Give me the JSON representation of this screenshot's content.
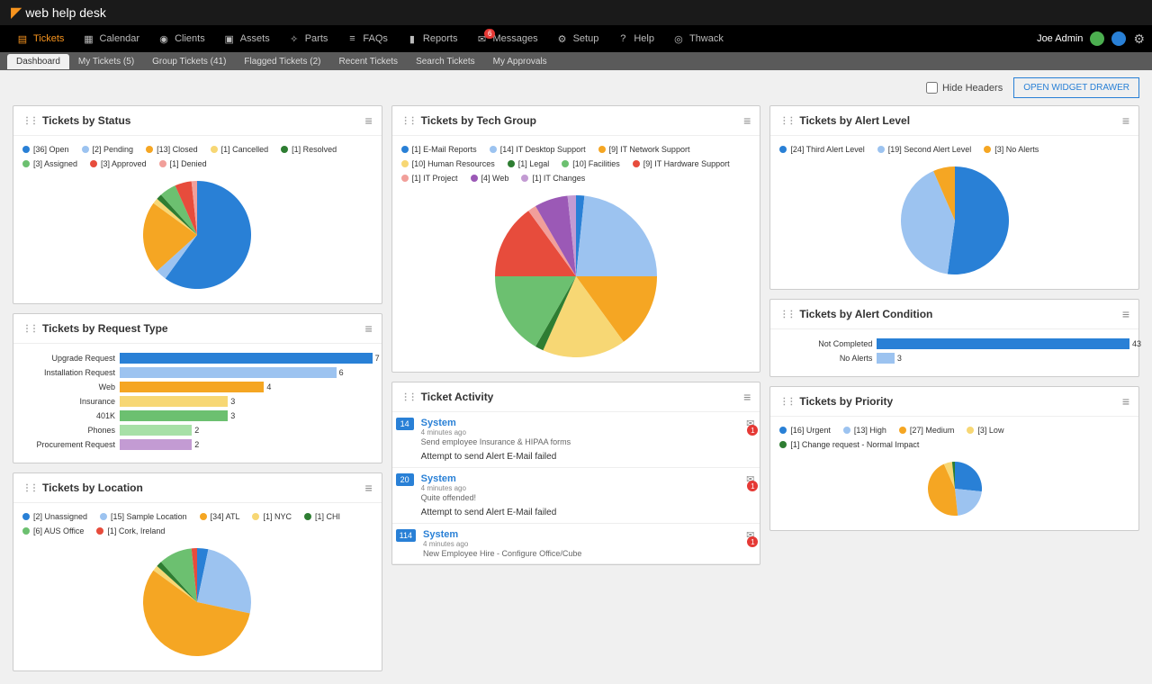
{
  "app_name": "web help desk",
  "nav": {
    "items": [
      {
        "icon": "tickets",
        "label": "Tickets",
        "active": true
      },
      {
        "icon": "calendar",
        "label": "Calendar"
      },
      {
        "icon": "clients",
        "label": "Clients"
      },
      {
        "icon": "assets",
        "label": "Assets"
      },
      {
        "icon": "parts",
        "label": "Parts"
      },
      {
        "icon": "faqs",
        "label": "FAQs"
      },
      {
        "icon": "reports",
        "label": "Reports"
      },
      {
        "icon": "messages",
        "label": "Messages",
        "badge": "6"
      },
      {
        "icon": "setup",
        "label": "Setup"
      },
      {
        "icon": "help",
        "label": "Help"
      },
      {
        "icon": "thwack",
        "label": "Thwack"
      }
    ],
    "user": "Joe Admin"
  },
  "subnav": [
    {
      "label": "Dashboard",
      "active": true
    },
    {
      "label": "My Tickets (5)"
    },
    {
      "label": "Group Tickets (41)"
    },
    {
      "label": "Flagged Tickets (2)"
    },
    {
      "label": "Recent Tickets"
    },
    {
      "label": "Search Tickets"
    },
    {
      "label": "My Approvals"
    }
  ],
  "toolbar": {
    "hide_headers": "Hide Headers",
    "open_drawer": "OPEN WIDGET DRAWER"
  },
  "widgets": {
    "status": {
      "title": "Tickets by Status",
      "items": [
        {
          "n": 36,
          "label": "Open",
          "color": "#2980d6"
        },
        {
          "n": 2,
          "label": "Pending",
          "color": "#9cc3f0"
        },
        {
          "n": 13,
          "label": "Closed",
          "color": "#f5a623"
        },
        {
          "n": 1,
          "label": "Cancelled",
          "color": "#f7d774"
        },
        {
          "n": 1,
          "label": "Resolved",
          "color": "#2e7d32"
        },
        {
          "n": 3,
          "label": "Assigned",
          "color": "#6cc070"
        },
        {
          "n": 3,
          "label": "Approved",
          "color": "#e74c3c"
        },
        {
          "n": 1,
          "label": "Denied",
          "color": "#f19f9a"
        }
      ]
    },
    "request_type": {
      "title": "Tickets by Request Type",
      "items": [
        {
          "label": "Upgrade Request",
          "n": 7,
          "color": "#2980d6"
        },
        {
          "label": "Installation Request",
          "n": 6,
          "color": "#9cc3f0"
        },
        {
          "label": "Web",
          "n": 4,
          "color": "#f5a623"
        },
        {
          "label": "Insurance",
          "n": 3,
          "color": "#f7d774"
        },
        {
          "label": "401K",
          "n": 3,
          "color": "#6cc070"
        },
        {
          "label": "Phones",
          "n": 2,
          "color": "#a7e0a7"
        },
        {
          "label": "Procurement Request",
          "n": 2,
          "color": "#c39bd3"
        }
      ]
    },
    "location": {
      "title": "Tickets by Location",
      "items": [
        {
          "n": 2,
          "label": "Unassigned",
          "color": "#2980d6"
        },
        {
          "n": 15,
          "label": "Sample Location",
          "color": "#9cc3f0"
        },
        {
          "n": 34,
          "label": "ATL",
          "color": "#f5a623"
        },
        {
          "n": 1,
          "label": "NYC",
          "color": "#f7d774"
        },
        {
          "n": 1,
          "label": "CHI",
          "color": "#2e7d32"
        },
        {
          "n": 6,
          "label": "AUS Office",
          "color": "#6cc070"
        },
        {
          "n": 1,
          "label": "Cork, Ireland",
          "color": "#e74c3c"
        }
      ]
    },
    "tech_group": {
      "title": "Tickets by Tech Group",
      "items": [
        {
          "n": 1,
          "label": "E-Mail Reports",
          "color": "#2980d6"
        },
        {
          "n": 14,
          "label": "IT Desktop Support",
          "color": "#9cc3f0"
        },
        {
          "n": 9,
          "label": "IT Network Support",
          "color": "#f5a623"
        },
        {
          "n": 10,
          "label": "Human Resources",
          "color": "#f7d774"
        },
        {
          "n": 1,
          "label": "Legal",
          "color": "#2e7d32"
        },
        {
          "n": 10,
          "label": "Facilities",
          "color": "#6cc070"
        },
        {
          "n": 9,
          "label": "IT Hardware Support",
          "color": "#e74c3c"
        },
        {
          "n": 1,
          "label": "IT Project",
          "color": "#f19f9a"
        },
        {
          "n": 4,
          "label": "Web",
          "color": "#9b59b6"
        },
        {
          "n": 1,
          "label": "IT Changes",
          "color": "#c39bd3"
        }
      ]
    },
    "activity": {
      "title": "Ticket Activity",
      "items": [
        {
          "id": "14",
          "who": "System",
          "time": "4 minutes ago",
          "desc": "Send employee Insurance & HIPAA forms",
          "msg": "Attempt to send Alert E-Mail failed",
          "alert": "1"
        },
        {
          "id": "20",
          "who": "System",
          "time": "4 minutes ago",
          "desc": "Quite offended!",
          "msg": "Attempt to send Alert E-Mail failed",
          "alert": "1"
        },
        {
          "id": "114",
          "who": "System",
          "time": "4 minutes ago",
          "desc": "New Employee Hire - Configure Office/Cube",
          "msg": "",
          "alert": "1"
        }
      ]
    },
    "alert_level": {
      "title": "Tickets by Alert Level",
      "items": [
        {
          "n": 24,
          "label": "Third Alert Level",
          "color": "#2980d6"
        },
        {
          "n": 19,
          "label": "Second Alert Level",
          "color": "#9cc3f0"
        },
        {
          "n": 3,
          "label": "No Alerts",
          "color": "#f5a623"
        }
      ]
    },
    "alert_condition": {
      "title": "Tickets by Alert Condition",
      "items": [
        {
          "label": "Not Completed",
          "n": 43,
          "color": "#2980d6"
        },
        {
          "label": "No Alerts",
          "n": 3,
          "color": "#9cc3f0"
        }
      ]
    },
    "priority": {
      "title": "Tickets by Priority",
      "items": [
        {
          "n": 16,
          "label": "Urgent",
          "color": "#2980d6"
        },
        {
          "n": 13,
          "label": "High",
          "color": "#9cc3f0"
        },
        {
          "n": 27,
          "label": "Medium",
          "color": "#f5a623"
        },
        {
          "n": 3,
          "label": "Low",
          "color": "#f7d774"
        },
        {
          "n": 1,
          "label": "Change request - Normal Impact",
          "color": "#2e7d32"
        }
      ]
    }
  },
  "chart_data": [
    {
      "type": "pie",
      "title": "Tickets by Status",
      "categories": [
        "Open",
        "Pending",
        "Closed",
        "Cancelled",
        "Resolved",
        "Assigned",
        "Approved",
        "Denied"
      ],
      "values": [
        36,
        2,
        13,
        1,
        1,
        3,
        3,
        1
      ]
    },
    {
      "type": "bar",
      "title": "Tickets by Request Type",
      "categories": [
        "Upgrade Request",
        "Installation Request",
        "Web",
        "Insurance",
        "401K",
        "Phones",
        "Procurement Request"
      ],
      "values": [
        7,
        6,
        4,
        3,
        3,
        2,
        2
      ],
      "xlim": [
        0,
        7
      ]
    },
    {
      "type": "pie",
      "title": "Tickets by Location",
      "categories": [
        "Unassigned",
        "Sample Location",
        "ATL",
        "NYC",
        "CHI",
        "AUS Office",
        "Cork, Ireland"
      ],
      "values": [
        2,
        15,
        34,
        1,
        1,
        6,
        1
      ]
    },
    {
      "type": "pie",
      "title": "Tickets by Tech Group",
      "categories": [
        "E-Mail Reports",
        "IT Desktop Support",
        "IT Network Support",
        "Human Resources",
        "Legal",
        "Facilities",
        "IT Hardware Support",
        "IT Project",
        "Web",
        "IT Changes"
      ],
      "values": [
        1,
        14,
        9,
        10,
        1,
        10,
        9,
        1,
        4,
        1
      ]
    },
    {
      "type": "pie",
      "title": "Tickets by Alert Level",
      "categories": [
        "Third Alert Level",
        "Second Alert Level",
        "No Alerts"
      ],
      "values": [
        24,
        19,
        3
      ]
    },
    {
      "type": "bar",
      "title": "Tickets by Alert Condition",
      "categories": [
        "Not Completed",
        "No Alerts"
      ],
      "values": [
        43,
        3
      ],
      "xlim": [
        0,
        43
      ]
    },
    {
      "type": "pie",
      "title": "Tickets by Priority",
      "categories": [
        "Urgent",
        "High",
        "Medium",
        "Low",
        "Change request - Normal Impact"
      ],
      "values": [
        16,
        13,
        27,
        3,
        1
      ]
    }
  ]
}
